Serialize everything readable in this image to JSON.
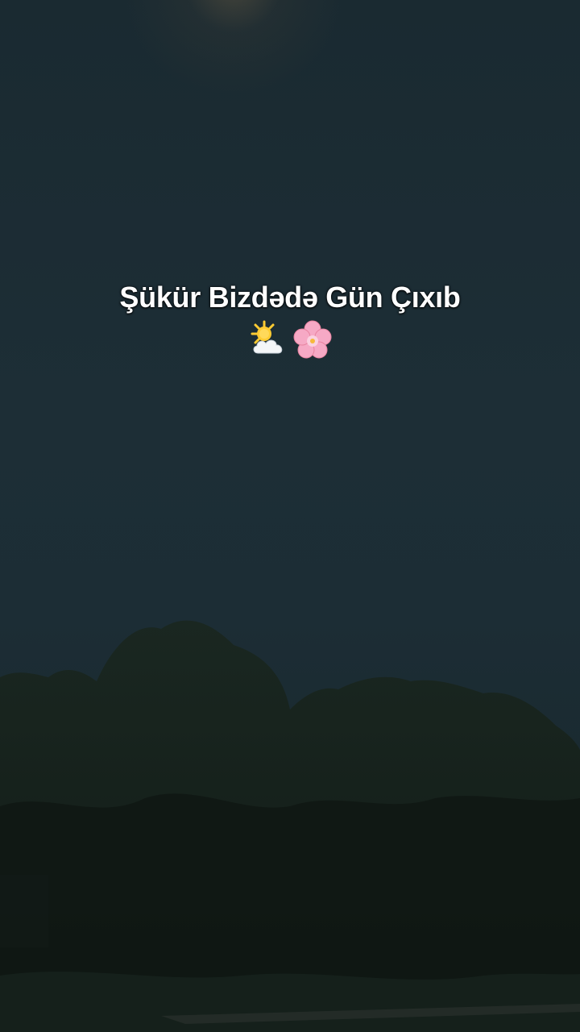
{
  "caption": {
    "text": "Şükür Bizdədə Gün Çıxıb"
  },
  "emojis": [
    {
      "icon": "sun-behind-cloud-icon"
    },
    {
      "icon": "cherry-blossom-icon"
    }
  ],
  "colors": {
    "sky": "#1b2a31",
    "trees": "#15201a",
    "caption_text": "#ffffff",
    "blossom": "#f6a9c5",
    "sun": "#ffcc33"
  }
}
